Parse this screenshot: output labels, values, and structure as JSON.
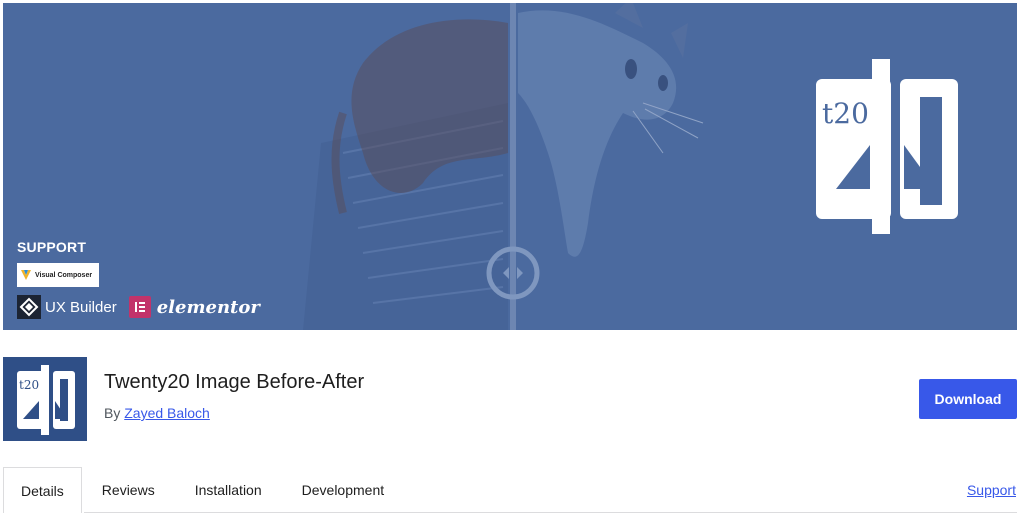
{
  "banner": {
    "support_label": "SUPPORT",
    "visual_composer_label": "Visual Composer",
    "ux_builder_label": "UX Builder",
    "elementor_label": "elementor",
    "logo_text": "t20",
    "bg_color": "#4b6a9f"
  },
  "plugin": {
    "title": "Twenty20 Image Before-After",
    "by_label": "By",
    "author": "Zayed Baloch",
    "icon_text": "t20",
    "icon_color": "#2f4f87"
  },
  "actions": {
    "download_label": "Download",
    "accent_color": "#3858e9"
  },
  "tabs": {
    "items": [
      {
        "label": "Details",
        "active": true
      },
      {
        "label": "Reviews",
        "active": false
      },
      {
        "label": "Installation",
        "active": false
      },
      {
        "label": "Development",
        "active": false
      }
    ],
    "support_link": "Support"
  }
}
